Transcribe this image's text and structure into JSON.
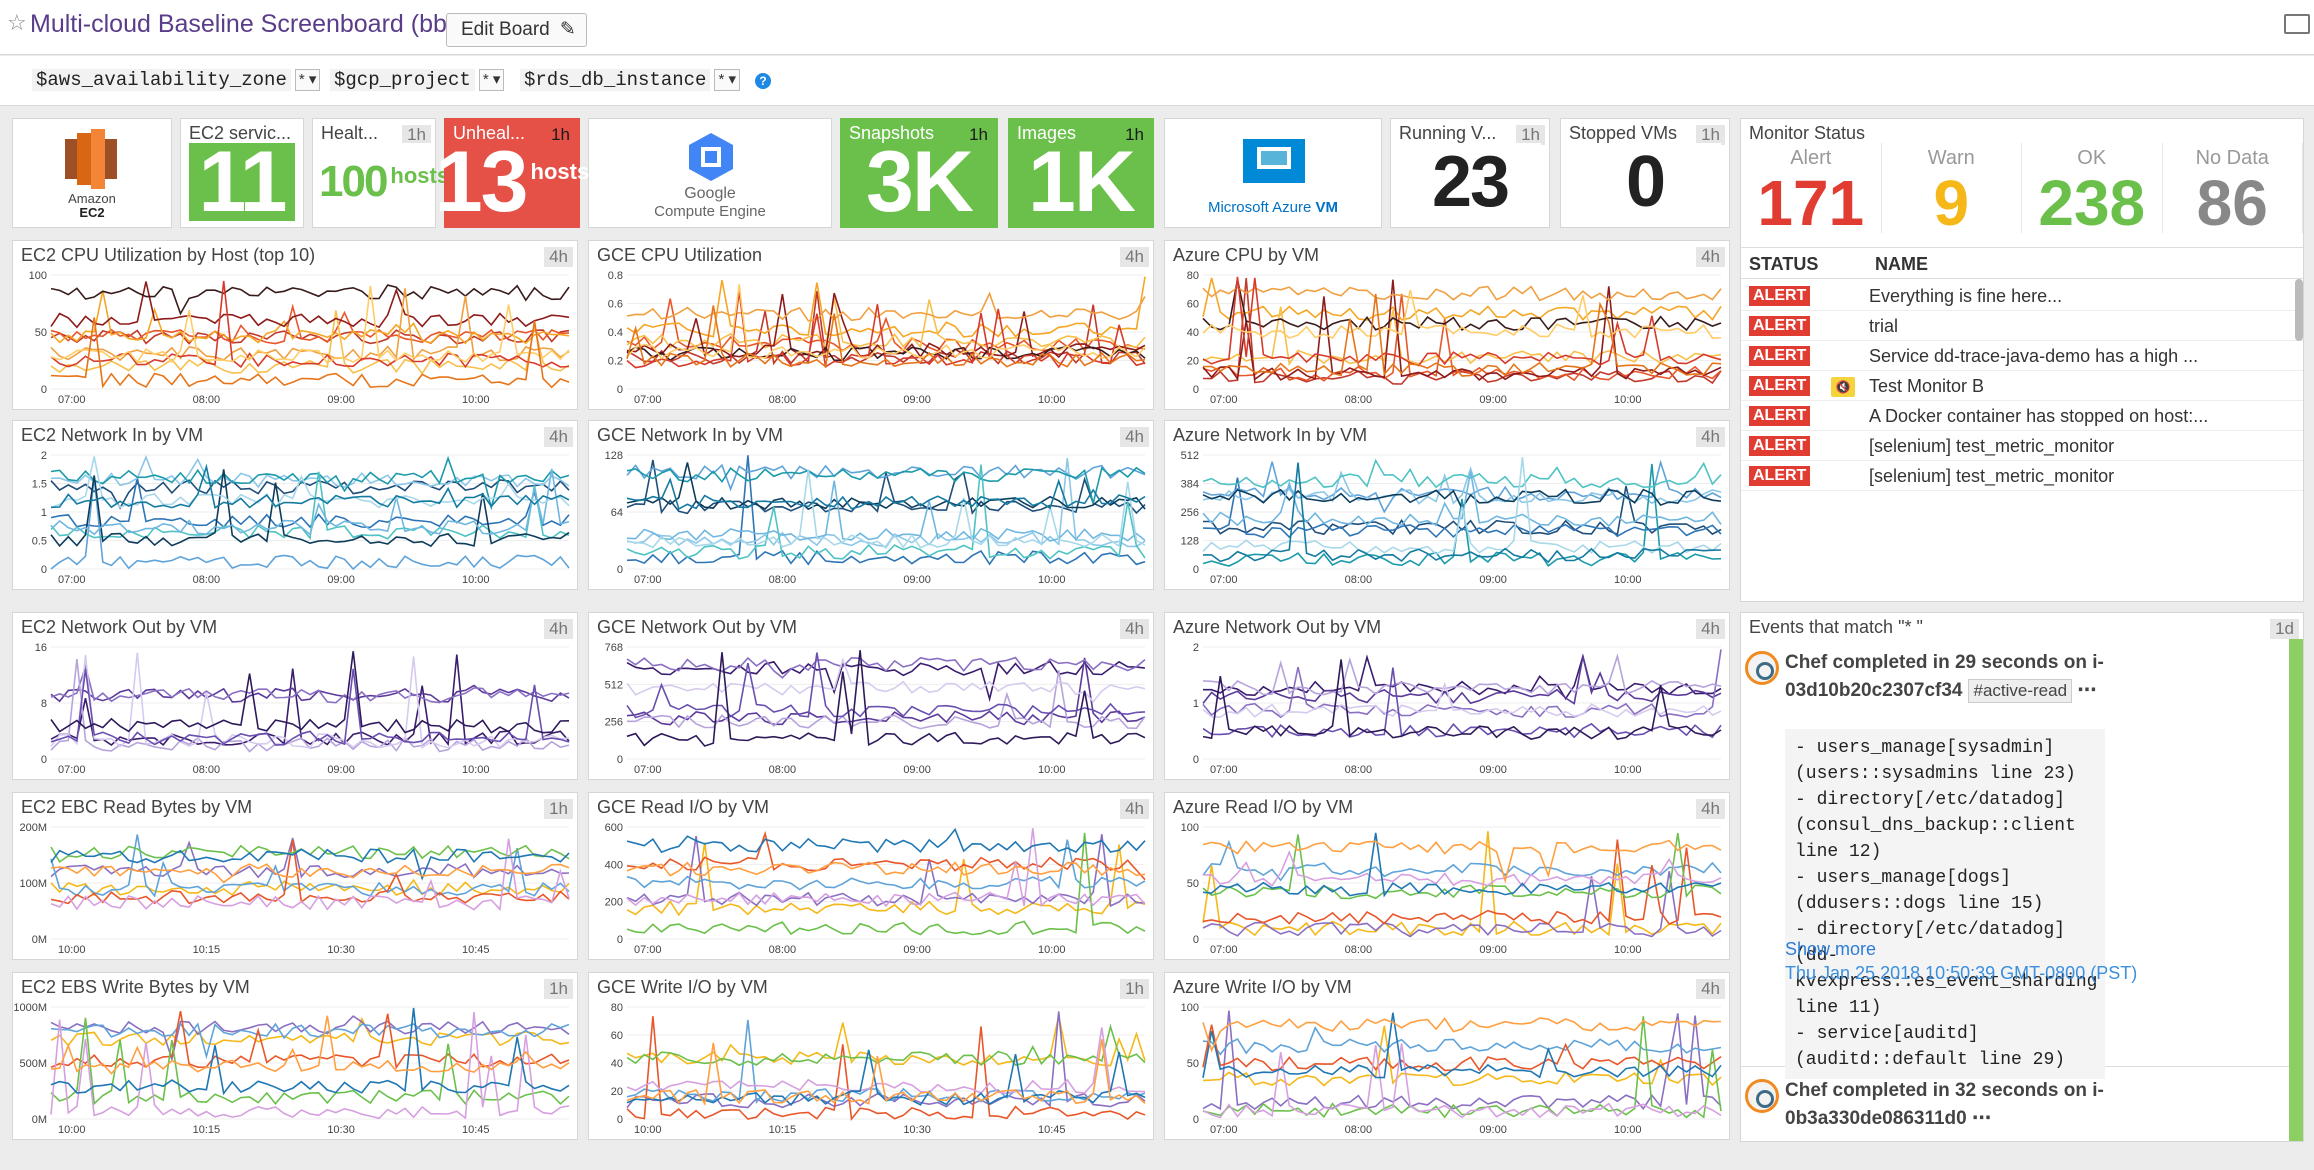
{
  "header": {
    "title": "Multi-cloud Baseline Screenboard (bb)",
    "edit_label": "Edit Board"
  },
  "template_vars": [
    {
      "name": "$aws_availability_zone",
      "value": "*"
    },
    {
      "name": "$gcp_project",
      "value": "*"
    },
    {
      "name": "$rds_db_instance",
      "value": "*"
    }
  ],
  "logos": {
    "aws": {
      "line1": "Amazon",
      "line2": "EC2"
    },
    "gce": {
      "line1": "Google",
      "line2": "Compute Engine"
    },
    "azure": {
      "text": "Microsoft Azure",
      "vm": "VM"
    }
  },
  "query_values": [
    {
      "id": "ec2svc",
      "title": "EC2 servic...",
      "badge": "",
      "value": "11",
      "unit": "",
      "style": "green"
    },
    {
      "id": "health",
      "title": "Healt...",
      "badge": "1h",
      "value": "100",
      "unit": "hosts",
      "style": "textgreen"
    },
    {
      "id": "unheal",
      "title": "Unheal...",
      "badge": "1h",
      "value": "13",
      "unit": "hosts",
      "style": "red"
    },
    {
      "id": "snap",
      "title": "Snapshots",
      "badge": "1h",
      "value": "3K",
      "unit": "",
      "style": "green"
    },
    {
      "id": "images",
      "title": "Images",
      "badge": "1h",
      "value": "1K",
      "unit": "",
      "style": "green"
    },
    {
      "id": "running",
      "title": "Running V...",
      "badge": "1h",
      "value": "23",
      "unit": "",
      "style": "plain"
    },
    {
      "id": "stopped",
      "title": "Stopped VMs",
      "badge": "1h",
      "value": "0",
      "unit": "",
      "style": "plain"
    }
  ],
  "monitor": {
    "title": "Monitor Status",
    "counts": [
      {
        "label": "Alert",
        "value": "171",
        "color": "#e03c31"
      },
      {
        "label": "Warn",
        "value": "9",
        "color": "#f5b818"
      },
      {
        "label": "OK",
        "value": "238",
        "color": "#6bc04b"
      },
      {
        "label": "No Data",
        "value": "86",
        "color": "#888888"
      }
    ],
    "col_status": "STATUS",
    "col_name": "NAME",
    "rows": [
      {
        "status": "ALERT",
        "name": "Everything is fine here...",
        "muted": false
      },
      {
        "status": "ALERT",
        "name": "trial",
        "muted": false
      },
      {
        "status": "ALERT",
        "name": "Service dd-trace-java-demo has a high ...",
        "muted": false
      },
      {
        "status": "ALERT",
        "name": "Test Monitor B",
        "muted": true
      },
      {
        "status": "ALERT",
        "name": "A Docker container has stopped on host:...",
        "muted": false
      },
      {
        "status": "ALERT",
        "name": "[selenium] test_metric_monitor",
        "muted": false
      },
      {
        "status": "ALERT",
        "name": "[selenium] test_metric_monitor",
        "muted": false
      }
    ]
  },
  "events": {
    "title": "Events that match \"* \"",
    "badge": "1d",
    "items": [
      {
        "title": "Chef completed in 29 seconds on i-03d10b20c2307cf34",
        "tag": "#active-read",
        "body": "- users_manage[sysadmin] (users::sysadmins line 23)\n- directory[/etc/datadog] (consul_dns_backup::client line 12)\n- users_manage[dogs] (ddusers::dogs line 15)\n- directory[/etc/datadog] (dd-kvexpress::es_event_sharding line 11)\n- service[auditd] (auditd::default line 29)",
        "more": "Show more",
        "date": "Thu Jan 25 2018 10:50:39 GMT-0800 (PST)"
      },
      {
        "title": "Chef completed in 32 seconds on i-0b3a330de086311d0"
      }
    ]
  },
  "graphs": [
    {
      "id": "g1",
      "title": "EC2 CPU Utilization by Host (top 10)",
      "badge": "4h",
      "yticks": [
        "100",
        "50",
        "0"
      ],
      "xticks": [
        "07:00",
        "08:00",
        "09:00",
        "10:00"
      ]
    },
    {
      "id": "g2",
      "title": "GCE CPU Utilization",
      "badge": "4h",
      "yticks": [
        "0.8",
        "0.6",
        "0.4",
        "0.2",
        "0"
      ],
      "xticks": [
        "07:00",
        "08:00",
        "09:00",
        "10:00"
      ]
    },
    {
      "id": "g3",
      "title": "Azure CPU by VM",
      "badge": "4h",
      "yticks": [
        "80",
        "60",
        "40",
        "20",
        "0"
      ],
      "xticks": [
        "07:00",
        "08:00",
        "09:00",
        "10:00"
      ]
    },
    {
      "id": "g4",
      "title": "EC2 Network In by VM",
      "badge": "4h",
      "yticks": [
        "2",
        "1.5",
        "1",
        "0.5",
        "0"
      ],
      "xticks": [
        "07:00",
        "08:00",
        "09:00",
        "10:00"
      ]
    },
    {
      "id": "g5",
      "title": "GCE Network In by VM",
      "badge": "4h",
      "yticks": [
        "128",
        "64",
        "0"
      ],
      "xticks": [
        "07:00",
        "08:00",
        "09:00",
        "10:00"
      ]
    },
    {
      "id": "g6",
      "title": "Azure Network In by VM",
      "badge": "4h",
      "yticks": [
        "512",
        "384",
        "256",
        "128",
        "0"
      ],
      "xticks": [
        "07:00",
        "08:00",
        "09:00",
        "10:00"
      ]
    },
    {
      "id": "g7",
      "title": "EC2 Network Out by VM",
      "badge": "4h",
      "yticks": [
        "16",
        "8",
        "0"
      ],
      "xticks": [
        "07:00",
        "08:00",
        "09:00",
        "10:00"
      ]
    },
    {
      "id": "g8",
      "title": "GCE Network Out by VM",
      "badge": "4h",
      "yticks": [
        "768",
        "512",
        "256",
        "0"
      ],
      "xticks": [
        "07:00",
        "08:00",
        "09:00",
        "10:00"
      ]
    },
    {
      "id": "g9",
      "title": "Azure Network Out by VM",
      "badge": "4h",
      "yticks": [
        "2",
        "1",
        "0"
      ],
      "xticks": [
        "07:00",
        "08:00",
        "09:00",
        "10:00"
      ]
    },
    {
      "id": "g10",
      "title": "EC2 EBC Read Bytes by VM",
      "badge": "1h",
      "yticks": [
        "200M",
        "100M",
        "0M"
      ],
      "xticks": [
        "10:00",
        "10:15",
        "10:30",
        "10:45"
      ]
    },
    {
      "id": "g11",
      "title": "GCE Read I/O by VM",
      "badge": "4h",
      "yticks": [
        "600",
        "400",
        "200",
        "0"
      ],
      "xticks": [
        "07:00",
        "08:00",
        "09:00",
        "10:00"
      ]
    },
    {
      "id": "g12",
      "title": "Azure Read I/O by VM",
      "badge": "4h",
      "yticks": [
        "100",
        "50",
        "0"
      ],
      "xticks": [
        "07:00",
        "08:00",
        "09:00",
        "10:00"
      ]
    },
    {
      "id": "g13",
      "title": "EC2 EBS Write Bytes by VM",
      "badge": "1h",
      "yticks": [
        "1000M",
        "500M",
        "0M"
      ],
      "xticks": [
        "10:00",
        "10:15",
        "10:30",
        "10:45"
      ]
    },
    {
      "id": "g14",
      "title": "GCE Write I/O by VM",
      "badge": "1h",
      "yticks": [
        "80",
        "60",
        "40",
        "20",
        "0"
      ],
      "xticks": [
        "10:00",
        "10:15",
        "10:30",
        "10:45"
      ]
    },
    {
      "id": "g15",
      "title": "Azure Write I/O by VM",
      "badge": "4h",
      "yticks": [
        "100",
        "50",
        "0"
      ],
      "xticks": [
        "07:00",
        "08:00",
        "09:00",
        "10:00"
      ]
    }
  ]
}
